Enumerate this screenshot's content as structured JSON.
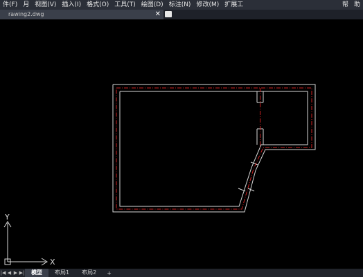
{
  "menubar": {
    "items": [
      "件(F)",
      "月",
      "视图(V)",
      "插入(I)",
      "格式(O)",
      "工具(T)",
      "绘图(D)",
      "标注(N)",
      "修改(M)",
      "扩展工",
      "帮",
      "助"
    ]
  },
  "tabs": {
    "drawing_tab": "rawing2.dwg",
    "close": "✕"
  },
  "ucs": {
    "x": "X",
    "y": "Y"
  },
  "layout_tabs": [
    "模型",
    "布局1",
    "布局2"
  ],
  "add_tab": "+",
  "colors": {
    "outline": "#d8d8d8",
    "centerline": "#cc2020"
  }
}
